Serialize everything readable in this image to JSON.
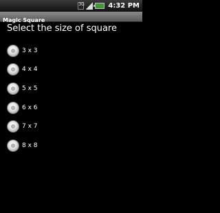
{
  "status_bar": {
    "network_label": "3G",
    "time": "4:32 PM",
    "icons": [
      "network-3g-icon",
      "signal-strength-icon",
      "battery-charging-icon"
    ]
  },
  "title_bar": {
    "title": "Magic Square"
  },
  "main": {
    "heading": "Select the size of square",
    "options": [
      {
        "label": "3 x 3",
        "selected": false
      },
      {
        "label": "4 x 4",
        "selected": false
      },
      {
        "label": "5 x 5",
        "selected": false
      },
      {
        "label": "6 x 6",
        "selected": false
      },
      {
        "label": "7 x 7",
        "selected": false
      },
      {
        "label": "8 x 8",
        "selected": false
      }
    ]
  },
  "colors": {
    "background": "#000000",
    "text": "#ffffff",
    "battery": "#3c9d2a"
  }
}
